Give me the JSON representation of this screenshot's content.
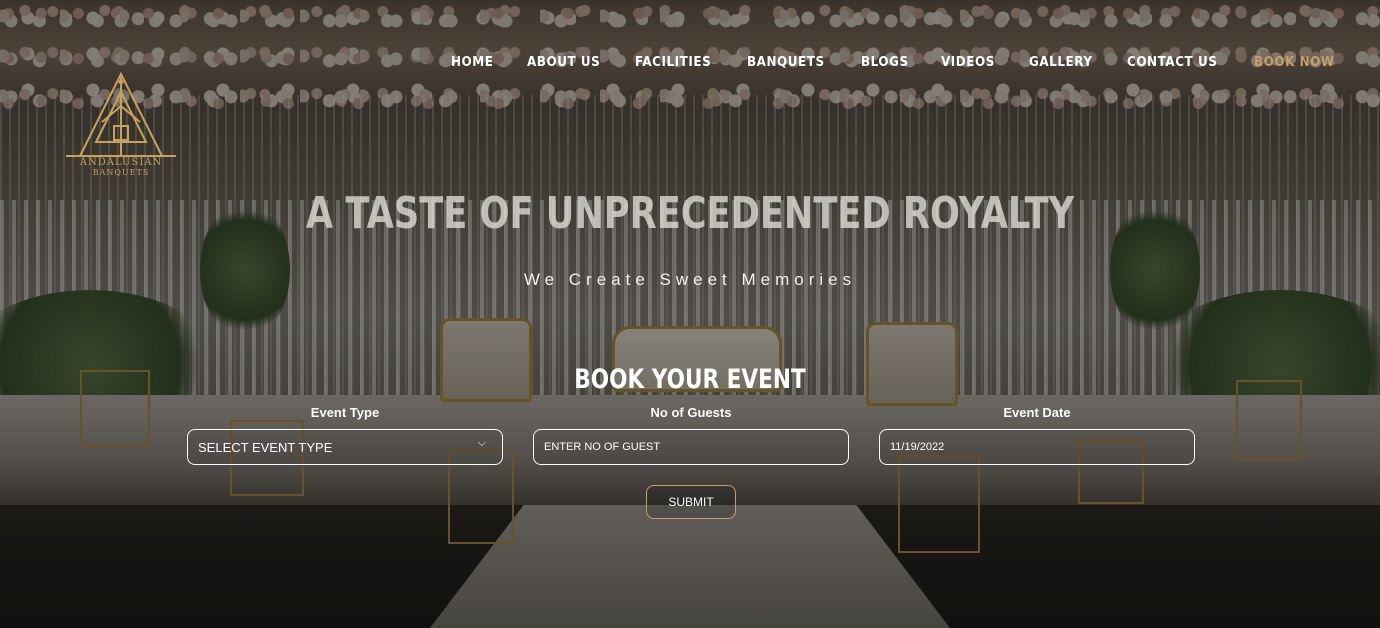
{
  "brand": {
    "logo_line1": "ANDALUSIAN",
    "logo_line2": "BANQUETS"
  },
  "nav": {
    "items": [
      {
        "label": "HOME"
      },
      {
        "label": "ABOUT US"
      },
      {
        "label": "FACILITIES"
      },
      {
        "label": "BANQUETS"
      },
      {
        "label": "BLOGS"
      },
      {
        "label": "VIDEOS"
      },
      {
        "label": "GALLERY"
      },
      {
        "label": "CONTACT US"
      },
      {
        "label": "BOOK NOW"
      }
    ],
    "accent_color": "#c5a064"
  },
  "hero": {
    "title": "A TASTE OF UNPRECEDENTED ROYALTY",
    "subtitle": "We Create Sweet Memories"
  },
  "booking": {
    "title": "BOOK YOUR EVENT",
    "event_type": {
      "label": "Event Type",
      "value": "SELECT EVENT TYPE"
    },
    "guests": {
      "label": "No of Guests",
      "placeholder": "ENTER NO OF GUEST"
    },
    "date": {
      "label": "Event Date",
      "value": "11/19/2022"
    },
    "submit_label": "SUBMIT"
  }
}
